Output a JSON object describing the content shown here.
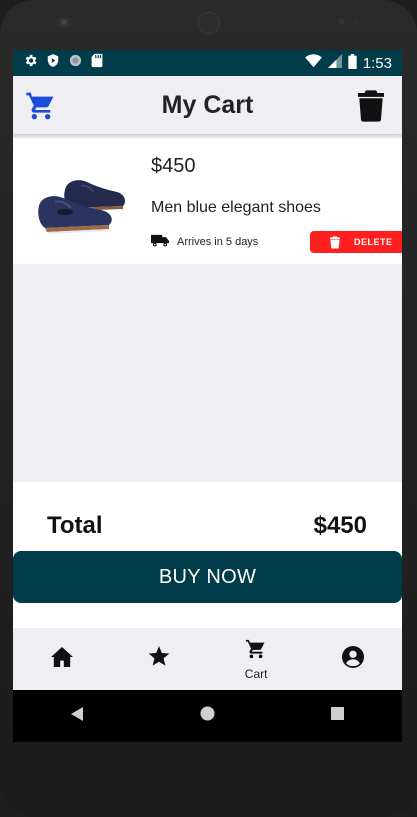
{
  "status_bar": {
    "time": "1:53"
  },
  "app_bar": {
    "title": "My Cart"
  },
  "cart_item": {
    "price": "$450",
    "name": "Men blue elegant shoes",
    "delivery": "Arrives in 5 days",
    "delete_label": "DELETE"
  },
  "summary": {
    "total_label": "Total",
    "total_value": "$450",
    "buy_label": "BUY NOW"
  },
  "bottom_nav": {
    "items": [
      {
        "icon": "home-icon",
        "label": ""
      },
      {
        "icon": "star-icon",
        "label": ""
      },
      {
        "icon": "cart-icon",
        "label": "Cart"
      },
      {
        "icon": "account-icon",
        "label": ""
      }
    ]
  },
  "colors": {
    "primary": "#003c49",
    "delete": "#ff1f1f",
    "cart_icon": "#1e4bd8",
    "background": "#eeeef3"
  }
}
